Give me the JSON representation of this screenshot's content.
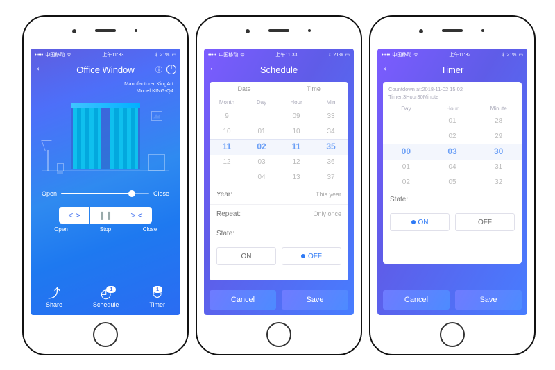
{
  "phone1": {
    "status": {
      "carrier": "中国移动",
      "wifi": "wifi-icon",
      "time": "上午11:33",
      "bt": "bt-icon",
      "battery": "21%"
    },
    "header": {
      "title": "Office Window"
    },
    "info": {
      "manufacturer_label": "Manufacturer:",
      "manufacturer": "KingArt",
      "model_label": "Model:",
      "model": "KING-Q4"
    },
    "slider": {
      "open_label": "Open",
      "close_label": "Close"
    },
    "controls": {
      "open": "Open",
      "stop": "Stop",
      "close": "Close"
    },
    "tabs": {
      "share": "Share",
      "schedule": "Schedule",
      "timer": "Timer",
      "schedule_badge": "1",
      "timer_badge": "1"
    }
  },
  "phone2": {
    "status": {
      "carrier": "中国移动",
      "wifi": "wifi-icon",
      "time": "上午11:33",
      "bt": "bt-icon",
      "battery": "21%"
    },
    "header": {
      "title": "Schedule"
    },
    "top": {
      "date": "Date",
      "time": "Time"
    },
    "cols": {
      "month": "Month",
      "day": "Day",
      "hour": "Hour",
      "min": "Min"
    },
    "wheel": {
      "r0": {
        "m": "9",
        "d": "",
        "h": "09",
        "mi": "33"
      },
      "r1": {
        "m": "10",
        "d": "01",
        "h": "10",
        "mi": "34"
      },
      "r2": {
        "m": "11",
        "d": "02",
        "h": "11",
        "mi": "35"
      },
      "r3": {
        "m": "12",
        "d": "03",
        "h": "12",
        "mi": "36"
      },
      "r4": {
        "m": "",
        "d": "04",
        "h": "13",
        "mi": "37"
      }
    },
    "year": {
      "k": "Year:",
      "v": "This year"
    },
    "repeat": {
      "k": "Repeat:",
      "v": "Only once"
    },
    "state_label": "State:",
    "state": {
      "on": "ON",
      "off": "OFF"
    },
    "footer": {
      "cancel": "Cancel",
      "save": "Save"
    }
  },
  "phone3": {
    "status": {
      "carrier": "中国移动",
      "wifi": "wifi-icon",
      "time": "上午11:32",
      "bt": "bt-icon",
      "battery": "21%"
    },
    "header": {
      "title": "Timer"
    },
    "note1": "Countdown at:2018-11-02 15:02",
    "note2": "Timer:3Hour30Minute",
    "cols": {
      "day": "Day",
      "hour": "Hour",
      "minute": "Minute"
    },
    "wheel": {
      "r0": {
        "d": "",
        "h": "01",
        "mi": "28"
      },
      "r1": {
        "d": "",
        "h": "02",
        "mi": "29"
      },
      "r2": {
        "d": "00",
        "h": "03",
        "mi": "30"
      },
      "r3": {
        "d": "01",
        "h": "04",
        "mi": "31"
      },
      "r4": {
        "d": "02",
        "h": "05",
        "mi": "32"
      }
    },
    "state_label": "State:",
    "state": {
      "on": "ON",
      "off": "OFF"
    },
    "footer": {
      "cancel": "Cancel",
      "save": "Save"
    }
  }
}
